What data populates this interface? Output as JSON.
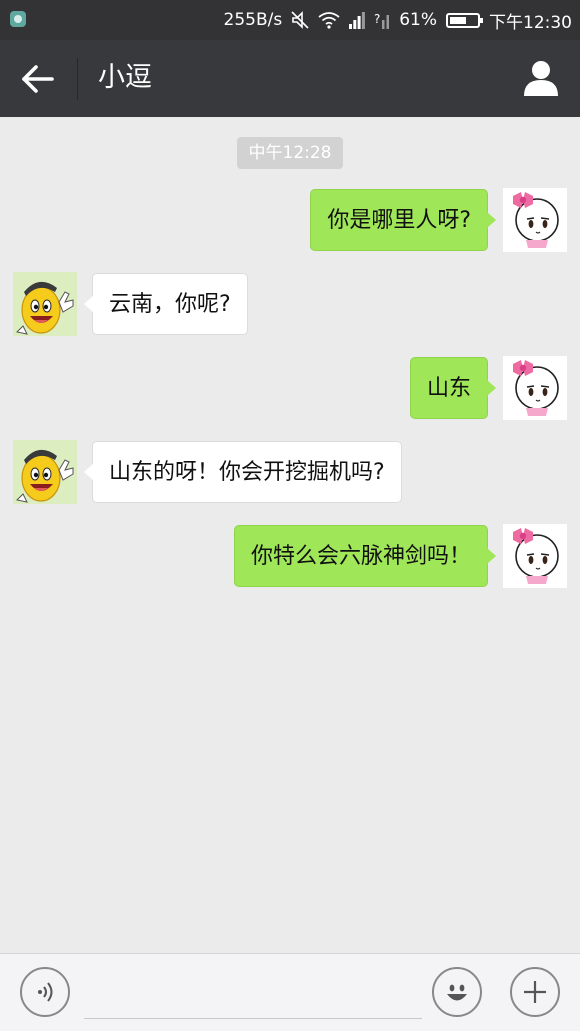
{
  "status_bar": {
    "net_speed": "255B/s",
    "battery": "61%",
    "battery_level": 0.61,
    "time": "下午12:30"
  },
  "header": {
    "title": "小逗",
    "back_icon": "back-arrow-icon",
    "profile_icon": "person-icon"
  },
  "chat": {
    "timestamp": "中午12:28",
    "messages": [
      {
        "side": "right",
        "text": "你是哪里人呀?",
        "avatar": "pink-bow-avatar"
      },
      {
        "side": "left",
        "text": "云南，你呢?",
        "avatar": "yellow-bean-avatar"
      },
      {
        "side": "right",
        "text": "山东",
        "avatar": "pink-bow-avatar"
      },
      {
        "side": "left",
        "text": "山东的呀！你会开挖掘机吗?",
        "avatar": "yellow-bean-avatar"
      },
      {
        "side": "right",
        "text": "你特么会六脉神剑吗！",
        "avatar": "pink-bow-avatar"
      }
    ]
  },
  "input_bar": {
    "placeholder": "",
    "voice_icon": "voice-icon",
    "emoji_icon": "emoji-icon",
    "plus_icon": "plus-icon"
  },
  "colors": {
    "header_bg": "#38393d",
    "status_bg": "#333335",
    "chat_bg": "#ebebeb",
    "sent_bubble": "#9fe658",
    "received_bubble": "#ffffff"
  }
}
